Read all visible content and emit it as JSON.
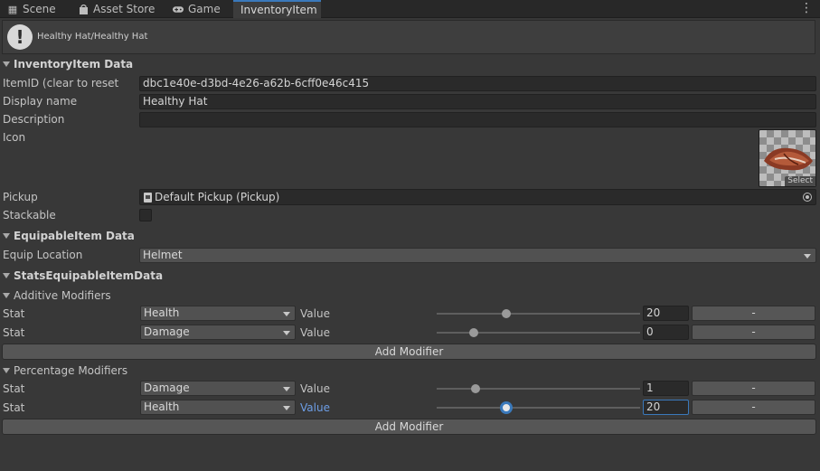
{
  "tabs": [
    {
      "label": "Scene",
      "icon": "grid-icon"
    },
    {
      "label": "Asset Store",
      "icon": "shopping-bag-icon"
    },
    {
      "label": "Game",
      "icon": "gamepad-icon"
    },
    {
      "label": "InventoryItem",
      "icon": "",
      "active": true
    }
  ],
  "header": {
    "title": "Healthy Hat/Healthy Hat"
  },
  "inventory": {
    "section": "InventoryItem Data",
    "item_id_label": "ItemID (clear to reset",
    "item_id": "dbc1e40e-d3bd-4e26-a62b-6cff0e46c415",
    "display_name_label": "Display name",
    "display_name": "Healthy Hat",
    "description_label": "Description",
    "description": "",
    "icon_label": "Icon",
    "icon_select": "Select",
    "pickup_label": "Pickup",
    "pickup": "Default Pickup (Pickup)",
    "stackable_label": "Stackable",
    "stackable": false
  },
  "equipable": {
    "section": "EquipableItem Data",
    "location_label": "Equip Location",
    "location": "Helmet"
  },
  "stats": {
    "section": "StatsEquipableItemData",
    "additive": {
      "title": "Additive Modifiers",
      "rows": [
        {
          "stat_label": "Stat",
          "stat": "Health",
          "value_label": "Value",
          "value": "20",
          "slider": 0.34,
          "remove": "-"
        },
        {
          "stat_label": "Stat",
          "stat": "Damage",
          "value_label": "Value",
          "value": "0",
          "slider": 0.18,
          "remove": "-"
        }
      ],
      "add_label": "Add Modifier"
    },
    "percentage": {
      "title": "Percentage Modifiers",
      "rows": [
        {
          "stat_label": "Stat",
          "stat": "Damage",
          "value_label": "Value",
          "value": "1",
          "slider": 0.19,
          "remove": "-"
        },
        {
          "stat_label": "Stat",
          "stat": "Health",
          "value_label": "Value",
          "value": "20",
          "slider": 0.34,
          "remove": "-",
          "focus": true
        }
      ],
      "add_label": "Add Modifier"
    }
  },
  "colors": {
    "accent": "#3a79bb",
    "focus_label": "#6d9ee6"
  }
}
